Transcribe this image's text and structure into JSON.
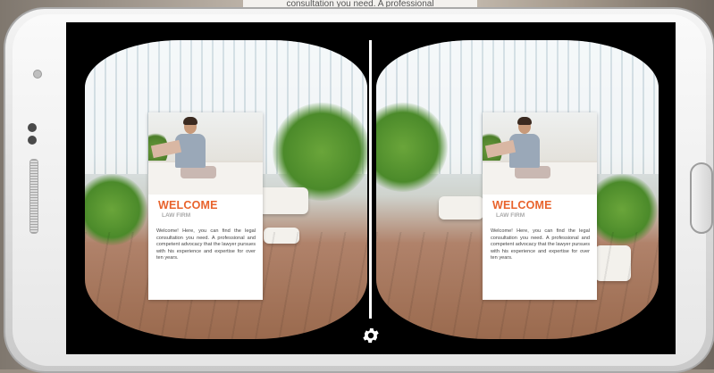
{
  "top_caption": "consultation you need. A professional",
  "card": {
    "title": "WELCOME",
    "subtitle": "LAW FIRM",
    "body": "Welcome! Here, you can find the legal consultation you need. A professional and competent advocacy that the lawyer pursues with his experience and expertise for over ten years."
  },
  "icons": {
    "settings": "gear-icon"
  },
  "colors": {
    "accent": "#e8632c",
    "screen_bg": "#000000",
    "subtitle": "#a9a9a9"
  }
}
